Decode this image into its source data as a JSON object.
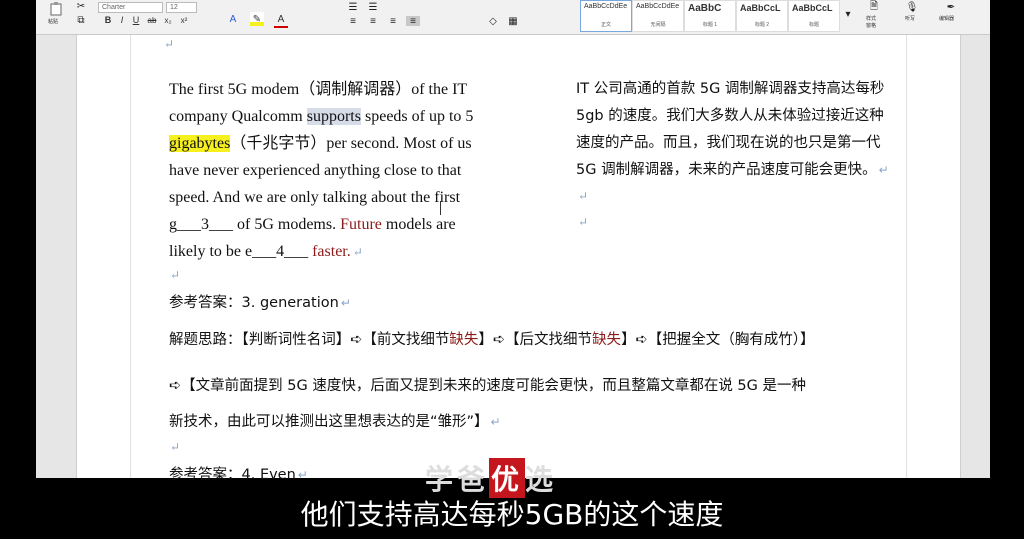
{
  "ribbon": {
    "paste_label": "粘贴",
    "font_name": "Charter",
    "font_size": "12",
    "bold": "B",
    "italic": "I",
    "underline": "U",
    "styles": [
      {
        "preview": "AaBbCcDdEe",
        "name": "正文"
      },
      {
        "preview": "AaBbCcDdEe",
        "name": "无间隔"
      },
      {
        "preview": "AaBbC",
        "name": "标题 1"
      },
      {
        "preview": "AaBbCcL",
        "name": "标题 2"
      },
      {
        "preview": "AaBbCcL",
        "name": "标题"
      }
    ],
    "style_pane_label": "样式\n窗格",
    "dictate_label": "听写",
    "editor_label": "编辑器"
  },
  "document": {
    "en_lines": [
      "The first 5G modem（调制解调器）of the IT",
      "company Qualcomm ",
      "supports",
      " speeds of up to 5",
      "gigabytes",
      "（千兆字节）per second. Most of us",
      "have never experienced anything close to that",
      "speed. And we are only talking about the first",
      "g___3___ of 5G modems. ",
      "Future",
      " models are",
      "likely to be e___4___ ",
      "faster."
    ],
    "zh_lines": [
      "IT 公司高通的首款 5G 调制解调器支持高达每秒",
      "5gb 的速度。我们大多数人从未体验过接近这种",
      "速度的产品。而且，我们现在说的也只是第一代",
      "5G 调制解调器，未来的产品速度可能会更快。"
    ],
    "answer3": "参考答案：3. generation",
    "thinking_prefix": "解题思路：【判断词性名词】➪【前文找细节",
    "missing1": "缺失",
    "thinking_mid": "】➪【后文找细节",
    "missing2": "缺失",
    "thinking_suffix": "】➪【把握全文（胸有成竹）】",
    "reason_line1": "➪【文章前面提到 5G 速度快，后面又提到未来的速度可能会更快，而且整篇文章都在说 5G 是一种",
    "reason_line2": "新技术，由此可以推测出这里想表达的是“雏形”】",
    "answer4": "参考答案：4. Even"
  },
  "watermark": {
    "part1": "学爸",
    "part2": "优",
    "part3": "选"
  },
  "subtitle": "他们支持高达每秒5GB的这个速度",
  "colors": {
    "highlight_yellow": "#f5f01e",
    "highlight_gray": "#d6dce8",
    "red_text": "#8b1a1a",
    "watermark_box": "#c4161c"
  }
}
